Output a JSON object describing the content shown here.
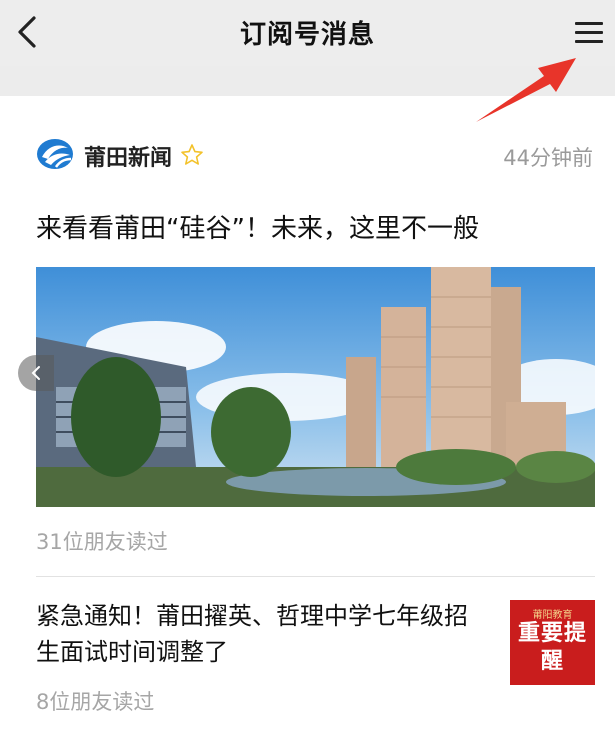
{
  "nav": {
    "title": "订阅号消息",
    "back_icon": "chevron-left-icon",
    "menu_icon": "hamburger-menu-icon"
  },
  "account": {
    "name": "莆田新闻",
    "time": "44分钟前",
    "logo_icon": "ptnews-logo-icon",
    "star_icon": "star-outline-icon",
    "star_color": "#f3c22b"
  },
  "articles": [
    {
      "title": "来看看莆田“硅谷”！未来，这里不一般",
      "reads": "31位朋友读过"
    },
    {
      "title": "紧急通知！莆田擢英、哲理中学七年级招生面试时间调整了",
      "reads": "8位朋友读过",
      "thumb_top": "莆阳教育",
      "thumb_text": "重要提醒"
    }
  ],
  "colors": {
    "annotation_arrow": "#e8342a",
    "thumb_bg": "#c91d1d"
  }
}
